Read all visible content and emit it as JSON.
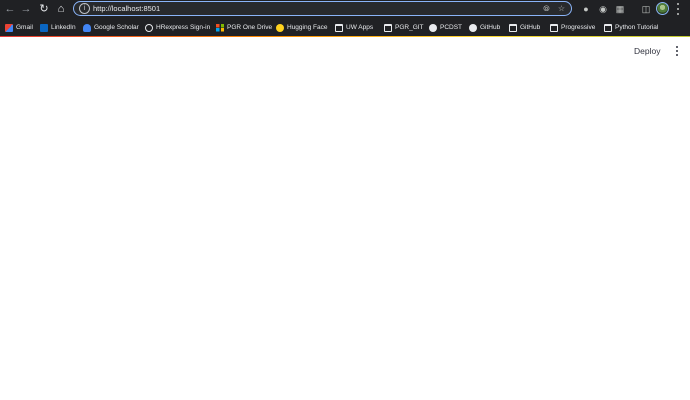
{
  "browser": {
    "url": "http://localhost:8501",
    "icons": {
      "back": "arrow-left-icon",
      "forward": "arrow-right-icon",
      "reload": "reload-icon",
      "home": "home-icon",
      "site_info": "info-icon",
      "tracking": "eye-off-icon",
      "bookmark_star": "star-icon",
      "extensions": "puzzle-icon",
      "side_panel": "side-panel-icon",
      "profile": "avatar",
      "menu": "kebab-menu-icon"
    }
  },
  "bookmarks": [
    {
      "label": "Gmail",
      "icon": "gmail-icon"
    },
    {
      "label": "LinkedIn",
      "icon": "linkedin-icon"
    },
    {
      "label": "Google Scholar",
      "icon": "google-scholar-icon"
    },
    {
      "label": "HRexpress Sign-in",
      "icon": "globe-icon"
    },
    {
      "label": "PGR One Drive",
      "icon": "microsoft-icon"
    },
    {
      "label": "Hugging Face",
      "icon": "hugging-face-icon"
    },
    {
      "label": "UW Apps",
      "icon": "folder-icon"
    },
    {
      "label": "PGR_GIT",
      "icon": "folder-icon"
    },
    {
      "label": "PCDST",
      "icon": "github-icon"
    },
    {
      "label": "GitHub",
      "icon": "github-icon"
    },
    {
      "label": "GitHub",
      "icon": "folder-icon"
    },
    {
      "label": "Progressive",
      "icon": "folder-icon"
    },
    {
      "label": "Python Tutorial",
      "icon": "folder-icon"
    }
  ],
  "app": {
    "deploy_label": "Deploy",
    "menu_icon": "kebab-menu-icon"
  }
}
